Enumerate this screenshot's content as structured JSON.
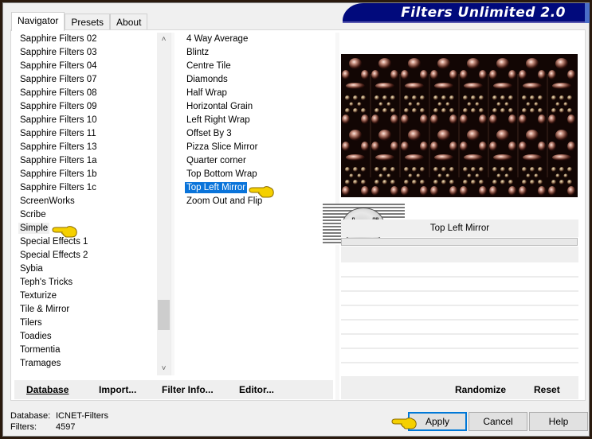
{
  "window": {
    "title": "Filters Unlimited 2.0"
  },
  "tabs": [
    {
      "label": "Navigator",
      "active": true
    },
    {
      "label": "Presets",
      "active": false
    },
    {
      "label": "About",
      "active": false
    }
  ],
  "categories": {
    "items": [
      "Sapphire Filters 02",
      "Sapphire Filters 03",
      "Sapphire Filters 04",
      "Sapphire Filters 07",
      "Sapphire Filters 08",
      "Sapphire Filters 09",
      "Sapphire Filters 10",
      "Sapphire Filters 11",
      "Sapphire Filters 13",
      "Sapphire Filters 1a",
      "Sapphire Filters 1b",
      "Sapphire Filters 1c",
      "ScreenWorks",
      "Scribe",
      "Simple",
      "Special Effects 1",
      "Special Effects 2",
      "Sybia",
      "Teph's Tricks",
      "Texturize",
      "Tile & Mirror",
      "Tilers",
      "Toadies",
      "Tormentia",
      "Tramages"
    ],
    "selected": "Simple",
    "scroll_position": 0.85
  },
  "filters": {
    "items": [
      "4 Way Average",
      "Blintz",
      "Centre Tile",
      "Diamonds",
      "Half Wrap",
      "Horizontal Grain",
      "Left Right Wrap",
      "Offset By 3",
      "Pizza Slice Mirror",
      "Quarter corner",
      "Top Bottom Wrap",
      "Top Left Mirror",
      "Zoom Out and Flip"
    ],
    "selected": "Top Left Mirror"
  },
  "preview": {
    "filter_name": "Top Left Mirror",
    "watermark": "claudia"
  },
  "left_buttons": {
    "database": "Database",
    "import": "Import...",
    "filter_info": "Filter Info...",
    "editor": "Editor..."
  },
  "right_buttons": {
    "randomize": "Randomize",
    "reset": "Reset"
  },
  "status": {
    "database_label": "Database:",
    "database_value": "ICNET-Filters",
    "filters_label": "Filters:",
    "filters_value": "4597"
  },
  "dialog_buttons": {
    "apply": "Apply",
    "cancel": "Cancel",
    "help": "Help"
  },
  "colors": {
    "selection": "#0a74da",
    "title_banner": "#010a7c",
    "pointer": "#f5d000"
  }
}
